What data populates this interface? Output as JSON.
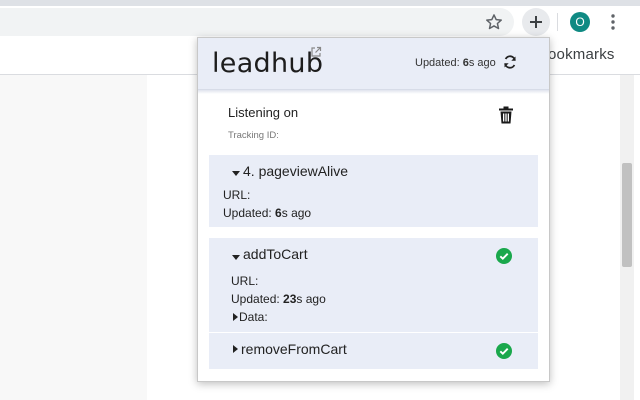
{
  "browser": {
    "bookmarks_partial": "ookmarks",
    "avatar_initial": "O"
  },
  "popup": {
    "logo_text": "leadhub",
    "updated_prefix": "Updated: ",
    "updated_value": "6",
    "updated_suffix": "s ago",
    "listening_label": "Listening on",
    "tracking_label": "Tracking ID:",
    "events": [
      {
        "title": "4. pageviewAlive",
        "url_label": "URL:",
        "updated_prefix": "Updated: ",
        "updated_value": "6",
        "updated_suffix": "s ago",
        "expanded": true,
        "status": "none"
      },
      {
        "title": "addToCart",
        "url_label": "URL:",
        "updated_prefix": "Updated: ",
        "updated_value": "23",
        "updated_suffix": "s ago",
        "data_label": "Data:",
        "expanded": true,
        "status": "success"
      },
      {
        "title": "removeFromCart",
        "expanded": false,
        "status": "success"
      }
    ]
  },
  "colors": {
    "accent_bg": "#e9edf7",
    "success": "#1aa84c",
    "avatar": "#0f8a83"
  },
  "icons": [
    "star-icon",
    "extensions-icon",
    "menu-icon",
    "external-link-icon",
    "refresh-icon",
    "trash-icon",
    "caret-down-icon",
    "caret-right-icon",
    "check-circle-icon"
  ]
}
